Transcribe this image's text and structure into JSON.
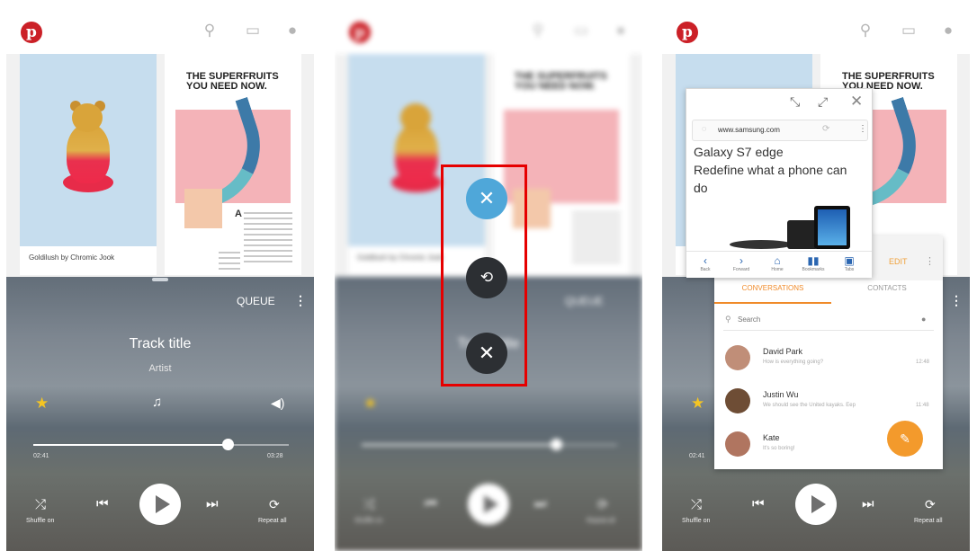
{
  "pinterest": {
    "logo": "p",
    "icons": [
      "search-icon",
      "message-icon",
      "user-icon"
    ],
    "pin1": {
      "caption": "Goldilush by Chromic Jook"
    },
    "pin2": {
      "headline": "THE SUPERFRUITS YOU NEED NOW.",
      "subhead": "A"
    }
  },
  "player": {
    "queue_label": "QUEUE",
    "track_title": "Track title",
    "artist": "Artist",
    "elapsed": "02:41",
    "duration": "03:28",
    "progress_fraction": 0.76,
    "shuffle_label": "Shuffle on",
    "repeat_label": "Repeat all"
  },
  "split_controls": {
    "buttons": [
      "close-window-icon",
      "swap-windows-icon",
      "close-split-icon"
    ],
    "highlight_color": "#e60000"
  },
  "browser_popup": {
    "url": "www.samsung.com",
    "headline_1": "Galaxy S7 edge",
    "headline_2": "Redefine what a phone can do",
    "nav": [
      {
        "label": "Back",
        "glyph": "‹"
      },
      {
        "label": "Forward",
        "glyph": "›"
      },
      {
        "label": "Home",
        "glyph": "⌂"
      },
      {
        "label": "Bookmarks",
        "glyph": "▮▮"
      },
      {
        "label": "Tabs",
        "glyph": "▣"
      }
    ]
  },
  "messenger": {
    "edit_label": "EDIT",
    "tabs": {
      "conversations": "CONVERSATIONS",
      "contacts": "CONTACTS"
    },
    "search_placeholder": "Search",
    "conversations": [
      {
        "name": "David Park",
        "preview": "How is everything going?",
        "time": "12:48",
        "avatar_color": "#c08e78"
      },
      {
        "name": "Justin Wu",
        "preview": "We should see the United kayaks. Eep",
        "time": "11:48",
        "avatar_color": "#6e4d35"
      },
      {
        "name": "Kate",
        "preview": "It's so boring!",
        "time": "",
        "avatar_color": "#b07560"
      }
    ],
    "accent_color": "#f08a29"
  }
}
